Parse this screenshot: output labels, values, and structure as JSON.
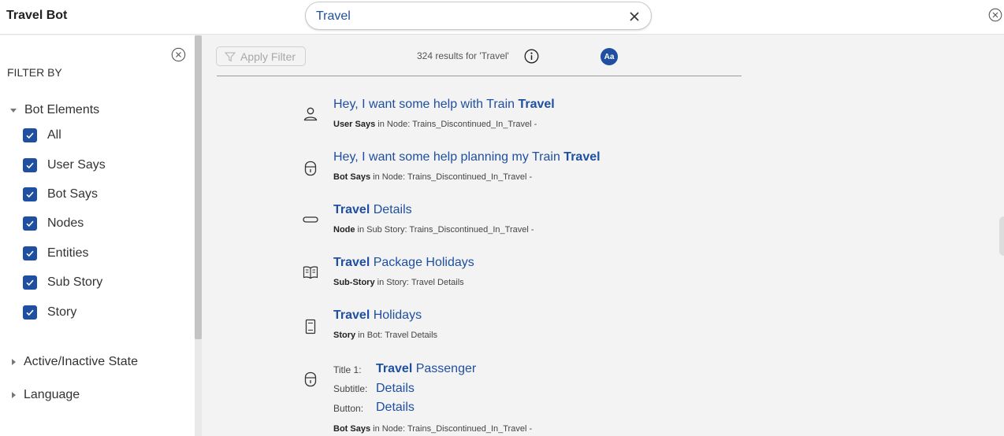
{
  "app_title": "Travel Bot",
  "search": {
    "value": "Travel"
  },
  "sidebar": {
    "filter_by": "FILTER BY",
    "sections": {
      "bot_elements": "Bot Elements",
      "active_state": "Active/Inactive State",
      "language": "Language"
    },
    "checkboxes": [
      "All",
      "User Says",
      "Bot Says",
      "Nodes",
      "Entities",
      "Sub Story",
      "Story"
    ]
  },
  "toolbar": {
    "apply_filter": "Apply Filter",
    "results_count": "324 results for 'Travel'",
    "case_badge": "Aa"
  },
  "results": [
    {
      "pre": "Hey, I want some help with Train ",
      "hl": "Travel",
      "post": "",
      "type": "User Says",
      "where": " in Node: Trains_Discontinued_In_Travel -",
      "icon": "user-icon"
    },
    {
      "pre": "Hey, I want some help planning my Train ",
      "hl": "Travel",
      "post": "",
      "type": "Bot Says",
      "where": " in Node: Trains_Discontinued_In_Travel -",
      "icon": "bot-icon"
    },
    {
      "pre": "",
      "hl": "Travel",
      "post": " Details",
      "type": "Node",
      "where": " in Sub Story: Trains_Discontinued_In_Travel -",
      "icon": "node-icon"
    },
    {
      "pre": "",
      "hl": "Travel",
      "post": " Package Holidays",
      "type": "Sub-Story",
      "where": " in Story: Travel Details",
      "icon": "book-icon"
    },
    {
      "pre": "",
      "hl": "Travel",
      "post": " Holidays",
      "type": "Story",
      "where": " in Bot: Travel Details",
      "icon": "story-icon"
    }
  ],
  "card_result": {
    "title_label": "Title 1:",
    "title_hl": "Travel",
    "title_post": " Passenger",
    "subtitle_label": "Subtitle:",
    "subtitle_value": "Details",
    "button_label": "Button:",
    "button_value": "Details",
    "type": "Bot Says",
    "where": " in Node: Trains_Discontinued_In_Travel -",
    "icon": "bot-icon"
  },
  "colors": {
    "accent": "#1f4fa0",
    "background": "#f3f3f3"
  }
}
